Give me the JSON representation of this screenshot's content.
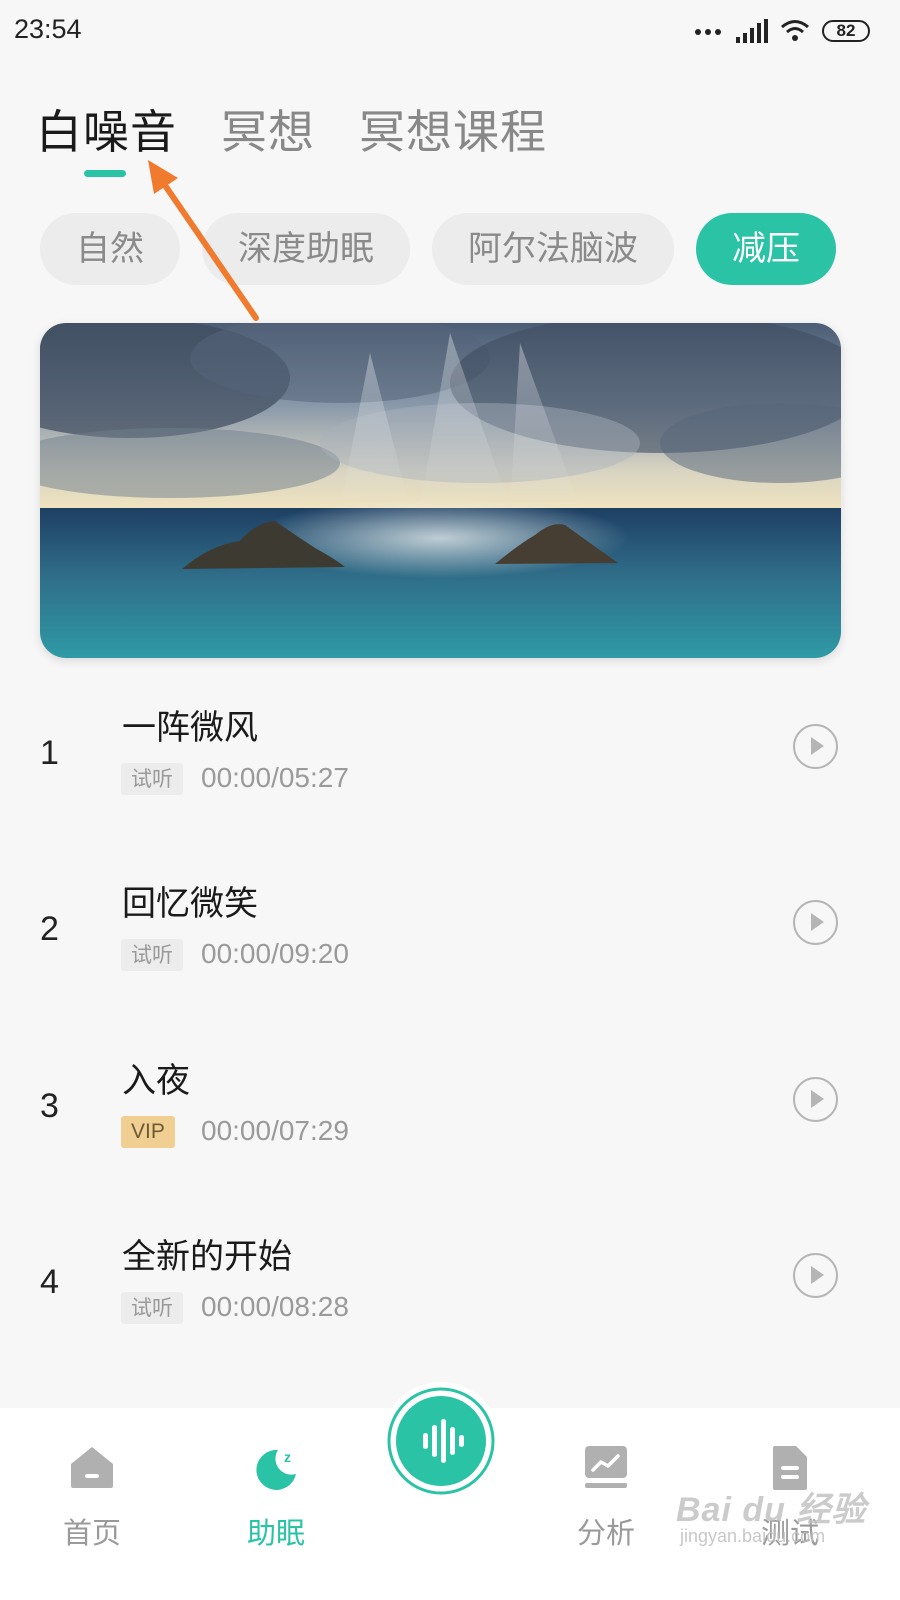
{
  "status_bar": {
    "time": "23:54",
    "battery": "82"
  },
  "top_tabs": [
    {
      "label": "白噪音",
      "active": true
    },
    {
      "label": "冥想",
      "active": false
    },
    {
      "label": "冥想课程",
      "active": false
    }
  ],
  "chips": [
    {
      "label": "自然",
      "active": false
    },
    {
      "label": "深度助眠",
      "active": false
    },
    {
      "label": "阿尔法脑波",
      "active": false
    },
    {
      "label": "减压",
      "active": true
    }
  ],
  "tracks": [
    {
      "index": "1",
      "title": "一阵微风",
      "badge": "试听",
      "time": "00:00/05:27"
    },
    {
      "index": "2",
      "title": "回忆微笑",
      "badge": "试听",
      "time": "00:00/09:20"
    },
    {
      "index": "3",
      "title": "入夜",
      "badge": "VIP",
      "time": "00:00/07:29"
    },
    {
      "index": "4",
      "title": "全新的开始",
      "badge": "试听",
      "time": "00:00/08:28"
    }
  ],
  "bottom_nav": [
    {
      "label": "首页",
      "icon": "home-icon",
      "active": false
    },
    {
      "label": "助眠",
      "icon": "moon-sleep-icon",
      "active": true
    },
    {
      "label": "",
      "icon": "sound-wave-icon",
      "active": false
    },
    {
      "label": "分析",
      "icon": "chart-analysis-icon",
      "active": false
    },
    {
      "label": "测试",
      "icon": "document-test-icon",
      "active": false
    }
  ],
  "watermark": {
    "main": "Bai du 经验",
    "sub": "jingyan.baidu.com"
  },
  "colors": {
    "accent": "#2bc3a5",
    "arrow": "#f07a2e",
    "vip": "#f1cf93"
  }
}
